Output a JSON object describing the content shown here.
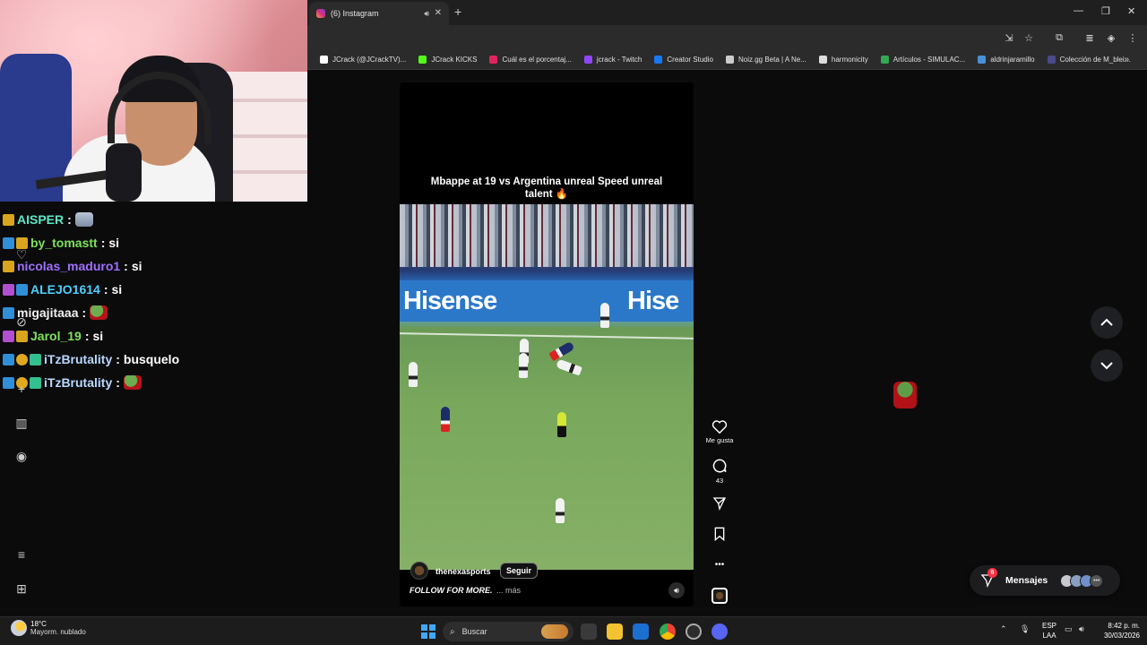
{
  "chat": [
    {
      "user": "AISPER",
      "color": "#5de6c8",
      "msg": "",
      "emote": "elephant",
      "badges": [
        "b-crown"
      ]
    },
    {
      "user": "by_tomastt",
      "color": "#7fe05a",
      "msg": "si",
      "emote": "",
      "badges": [
        "b-sub",
        "b-crown"
      ]
    },
    {
      "user": "nicolas_maduro1",
      "color": "#a070ff",
      "msg": "si",
      "emote": "",
      "badges": [
        "b-crown"
      ]
    },
    {
      "user": "ALEJO1614",
      "color": "#4fd0ff",
      "msg": "si",
      "emote": "",
      "badges": [
        "b-pink",
        "b-sub"
      ]
    },
    {
      "user": "migajitaaa",
      "color": "#f0f0f0",
      "msg": "",
      "emote": "pepe",
      "badges": [
        "b-sub"
      ]
    },
    {
      "user": "Jarol_19",
      "color": "#7fe05a",
      "msg": "si",
      "emote": "",
      "badges": [
        "b-pink",
        "b-crown"
      ]
    },
    {
      "user": "iTzBrutality",
      "color": "#b8d8ff",
      "msg": "busquelo",
      "emote": "",
      "badges": [
        "b-sub",
        "b-gold",
        "b-green"
      ]
    },
    {
      "user": "iTzBrutality",
      "color": "#b8d8ff",
      "msg": "",
      "emote": "pepe",
      "badges": [
        "b-sub",
        "b-gold",
        "b-green"
      ]
    }
  ],
  "browser": {
    "tab_title": "(6) Instagram",
    "bookmarks": [
      {
        "label": "JCrack (@JCrackTV)...",
        "color": "#ffffff"
      },
      {
        "label": "JCrack KICKS",
        "color": "#53fc18"
      },
      {
        "label": "Cuál es el porcentaj...",
        "color": "#e0245e"
      },
      {
        "label": "jcrack - Twitch",
        "color": "#9146ff"
      },
      {
        "label": "Creator Studio",
        "color": "#1877f2"
      },
      {
        "label": "Noiz.gg Beta | A Ne...",
        "color": "#cccccc"
      },
      {
        "label": "harmonicity",
        "color": "#dddddd"
      },
      {
        "label": "Artículos - SIMULAC...",
        "color": "#34a853"
      },
      {
        "label": "aldrinjaramillo",
        "color": "#4a90d9"
      },
      {
        "label": "Colección de M_blei...",
        "color": "#4a4a8c"
      }
    ]
  },
  "reel": {
    "caption": "Mbappe at 19 vs Argentina unreal Speed unreal talent 🔥",
    "billboard": "Hisense",
    "billboard_partial": "Hise",
    "username": "thenexasports",
    "follow_label": "Seguir",
    "description": "FOLLOW FOR MORE.",
    "more_label": "... más",
    "like_label": "Me gusta",
    "comments_count": "43",
    "more_icon": "•••"
  },
  "messages": {
    "label": "Mensajes",
    "count": "6"
  },
  "taskbar": {
    "temp": "18°C",
    "weather": "Mayorm. nublado",
    "search": "Buscar",
    "lang_1": "ESP",
    "lang_2": "LAA",
    "time": "8:42 p. m.",
    "date": "30/03/2026"
  }
}
